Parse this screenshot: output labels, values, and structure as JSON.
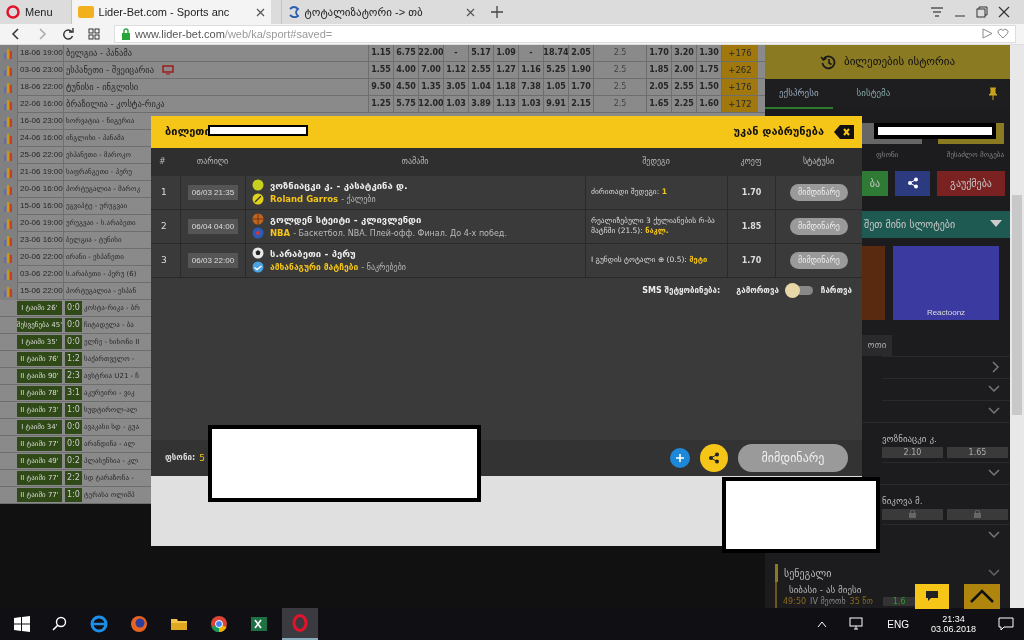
{
  "browser": {
    "menu": "Menu",
    "tabs": [
      {
        "label": "Lider-Bet.com - Sports anc",
        "kind": "site",
        "selected": true
      },
      {
        "label": "ტოტალიზატორი -> თბ",
        "kind": "ge",
        "selected": false
      }
    ],
    "address_host": "www.lider-bet.com",
    "address_path": "/web/ka/sport#saved="
  },
  "odds_table": {
    "rows": [
      {
        "date": "18-06 19:00",
        "match": "ბელგია - პანამა",
        "tv": false,
        "odds": [
          "1.15",
          "6.75",
          "22.00",
          "-",
          "5.17",
          "1.09",
          "-",
          "18.74",
          "2.05",
          "2.5",
          "1.70",
          "3.20",
          "1.30"
        ],
        "more": "+176"
      },
      {
        "date": "03-06 23:00",
        "match": "ესპანეთი - შვეიცარია",
        "tv": true,
        "odds": [
          "1.55",
          "4.00",
          "7.00",
          "1.12",
          "2.55",
          "1.27",
          "1.16",
          "5.25",
          "1.90",
          "2.5",
          "1.85",
          "2.00",
          "1.75"
        ],
        "more": "+262"
      },
      {
        "date": "18-06 22:00",
        "match": "ტუნისი - ინგლისი",
        "tv": false,
        "odds": [
          "9.50",
          "4.50",
          "1.35",
          "3.05",
          "1.04",
          "1.18",
          "7.38",
          "1.05",
          "1.70",
          "2.5",
          "2.05",
          "2.55",
          "1.50"
        ],
        "more": "+176"
      },
      {
        "date": "22-06 16:00",
        "match": "ბრაზილია - კოსტა-რიკა",
        "tv": false,
        "odds": [
          "1.25",
          "5.75",
          "12.00",
          "1.03",
          "3.89",
          "1.13",
          "1.03",
          "9.91",
          "2.15",
          "2.5",
          "1.65",
          "2.25",
          "1.60"
        ],
        "more": "+172"
      },
      {
        "date": "16-06 23:00",
        "match": "ხორვატია - ნიგერია",
        "tv": false
      },
      {
        "date": "24-06 16:00",
        "match": "ინგლისი - პანამა",
        "tv": false
      },
      {
        "date": "25-06 22:00",
        "match": "ესპანეთი - მაროკო",
        "tv": false
      },
      {
        "date": "21-06 19:00",
        "match": "საფრანგეთი - პერუ",
        "tv": false
      },
      {
        "date": "20-06 16:00",
        "match": "პორტუგალია - მაროკ",
        "tv": false
      },
      {
        "date": "15-06 16:00",
        "match": "ეგვიპტე - ურუგვაი",
        "tv": false
      },
      {
        "date": "20-06 19:00",
        "match": "ურუგვაი - ს.არაბეთი",
        "tv": false
      },
      {
        "date": "23-06 16:00",
        "match": "ბელგია - ტუნისი",
        "tv": false
      },
      {
        "date": "20-06 22:00",
        "match": "ირანი - ესპანეთი",
        "tv": false
      },
      {
        "date": "03-06 22:00",
        "match": "ს.არაბეთი - პერუ (6)",
        "tv": false
      },
      {
        "date": "15-06 22:00",
        "match": "პორტუგალია - ესპან",
        "tv": false
      }
    ],
    "live_rows": [
      {
        "period": "I ტაიმი 26'",
        "score": "0:0",
        "match": "კოსტა-რიკა - ბრ"
      },
      {
        "period": "შესვენება 45'",
        "score": "0:0",
        "match": "ჩიტადელა - ბა"
      },
      {
        "period": "I ტაიმი 35'",
        "score": "0:0",
        "match": "ელჩე - ხიხონი II"
      },
      {
        "period": "II ტაიმი 76'",
        "score": "1:2",
        "match": "საქართველო -"
      },
      {
        "period": "II ტაიმი 90'",
        "score": "2:3",
        "match": "ავსტრია U21 - ჩ"
      },
      {
        "period": "II ტაიმი 78'",
        "score": "3:1",
        "match": "აკურეირი - ვიკ"
      },
      {
        "period": "II ტაიმი 73'",
        "score": "1:0",
        "match": "სუდტიროლ-ალ"
      },
      {
        "period": "I ტაიმი 34'",
        "score": "0:0",
        "match": "ავაკასი სდ - გუა"
      },
      {
        "period": "II ტაიმი 77'",
        "score": "0:0",
        "match": "არანდინა - ალ"
      },
      {
        "period": "II ტაიმი 49'",
        "score": "0:2",
        "match": "პლასენსია - კლ"
      },
      {
        "period": "II ტაიმი 77'",
        "score": "2:2",
        "match": "სდ ტარაზონა -"
      },
      {
        "period": "II ტაიმი 77'",
        "score": "1:0",
        "match": "ტერასა ოლიმპ"
      }
    ]
  },
  "sidebar": {
    "title": "ბილეთების ისტორია",
    "tabs": [
      {
        "label": "ექსპრესი",
        "selected": true
      },
      {
        "label": "სისტემა",
        "selected": false
      }
    ],
    "stake_label": "ფსონი",
    "win_label": "შესაძლო მოგება",
    "confirm": "ბა",
    "cancel": "გაუქმება",
    "slots": "შეთ მინი სლოტები",
    "game": "Reactoonz",
    "tab_fragment": "ოთი",
    "events": [
      {
        "kind": "arrow"
      },
      {
        "kind": "chevron"
      },
      {
        "kind": "chevron"
      },
      {
        "kind": "match",
        "name": "ვოზნიაცკი კ.",
        "odds": [
          "2.10",
          "1.65"
        ]
      },
      {
        "kind": "chevron"
      },
      {
        "kind": "locked",
        "name": "ნიკოვა მ."
      },
      {
        "kind": "chevron"
      }
    ],
    "country": "სენეგალი",
    "live": {
      "name": "სიბასი - ას მიესი",
      "clock": "49:50",
      "period": "IV მეოთხ",
      "minute": "35 წთ",
      "odd": "1.6"
    }
  },
  "modal": {
    "title": "ბილეთი",
    "back": "უკან დაბრუნება",
    "columns": [
      "#",
      "თარიღი",
      "თამაში",
      "შედეგი",
      "კოეფ",
      "სტატუსი"
    ],
    "bets": [
      {
        "num": "1",
        "date": "06/03 21:35",
        "kind": "tennis",
        "match": "ვოზნიაცკი კ. - კასატკინა დ.",
        "league": "Roland Garros",
        "category": "- ქალები",
        "result": "ძირითადი შედეგი: ",
        "pick": "1",
        "odds": "1.70",
        "status": "მიმდინარე"
      },
      {
        "num": "2",
        "date": "06/04 04:00",
        "kind": "basketball",
        "match": "გოლდენ სტეიტი - კლივლენდი",
        "league": "NBA",
        "category": "- Баскетбол. NBA. Плей-офф. Финал. До 4-х побед.",
        "result": "რეალიზებული 3 ქულიანების რ-ბა მატჩში (21.5): ",
        "pick": "ნაკლ.",
        "odds": "1.85",
        "status": "მიმდინარე"
      },
      {
        "num": "3",
        "date": "06/03 22:00",
        "kind": "football",
        "match": "ს.არაბეთი - პერუ",
        "league": "ამხანაგური მატჩები",
        "category": "- ნაკრებები",
        "result": "I გუნდის ტოტალი ⊕ (0.5): ",
        "pick": "მეტი",
        "odds": "1.70",
        "status": "მიმდინარე"
      }
    ],
    "sms": {
      "label": "SMS შეტყობინება:",
      "off_label": "გამორთვა",
      "on_label": "ჩართვა",
      "on": false
    },
    "footer": {
      "stake_label": "ფსონი:",
      "stake": "5",
      "status": "მიმდინარე"
    }
  },
  "taskbar": {
    "lang": "ENG",
    "time": "21:34",
    "date": "03.06.2018"
  }
}
